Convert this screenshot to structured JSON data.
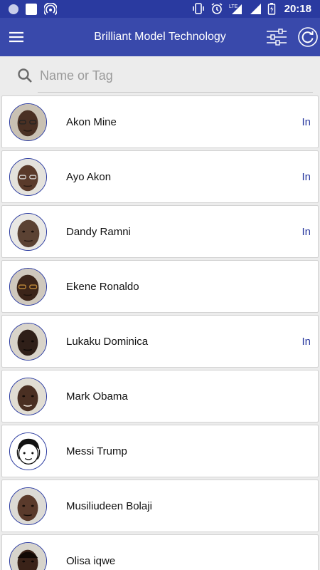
{
  "status_bar": {
    "time": "20:18",
    "network_label": "LTE"
  },
  "app_bar": {
    "title": "Brilliant Model Technology"
  },
  "search": {
    "placeholder": "Name or Tag",
    "value": ""
  },
  "contacts": [
    {
      "name": "Akon Mine",
      "status": "In",
      "avatar": "photo"
    },
    {
      "name": "Ayo Akon",
      "status": "In",
      "avatar": "photo"
    },
    {
      "name": "Dandy Ramni",
      "status": "In",
      "avatar": "photo"
    },
    {
      "name": "Ekene Ronaldo",
      "status": "",
      "avatar": "photo"
    },
    {
      "name": "Lukaku Dominica",
      "status": "In",
      "avatar": "photo"
    },
    {
      "name": "Mark Obama",
      "status": "",
      "avatar": "photo"
    },
    {
      "name": "Messi Trump",
      "status": "",
      "avatar": "cartoon"
    },
    {
      "name": "Musiliudeen Bolaji",
      "status": "",
      "avatar": "photo"
    },
    {
      "name": "Olisa iqwe",
      "status": "",
      "avatar": "photo"
    }
  ],
  "colors": {
    "primary": "#3949ab",
    "status_bar": "#2a3aa0",
    "accent_text": "#2a3aa0"
  }
}
